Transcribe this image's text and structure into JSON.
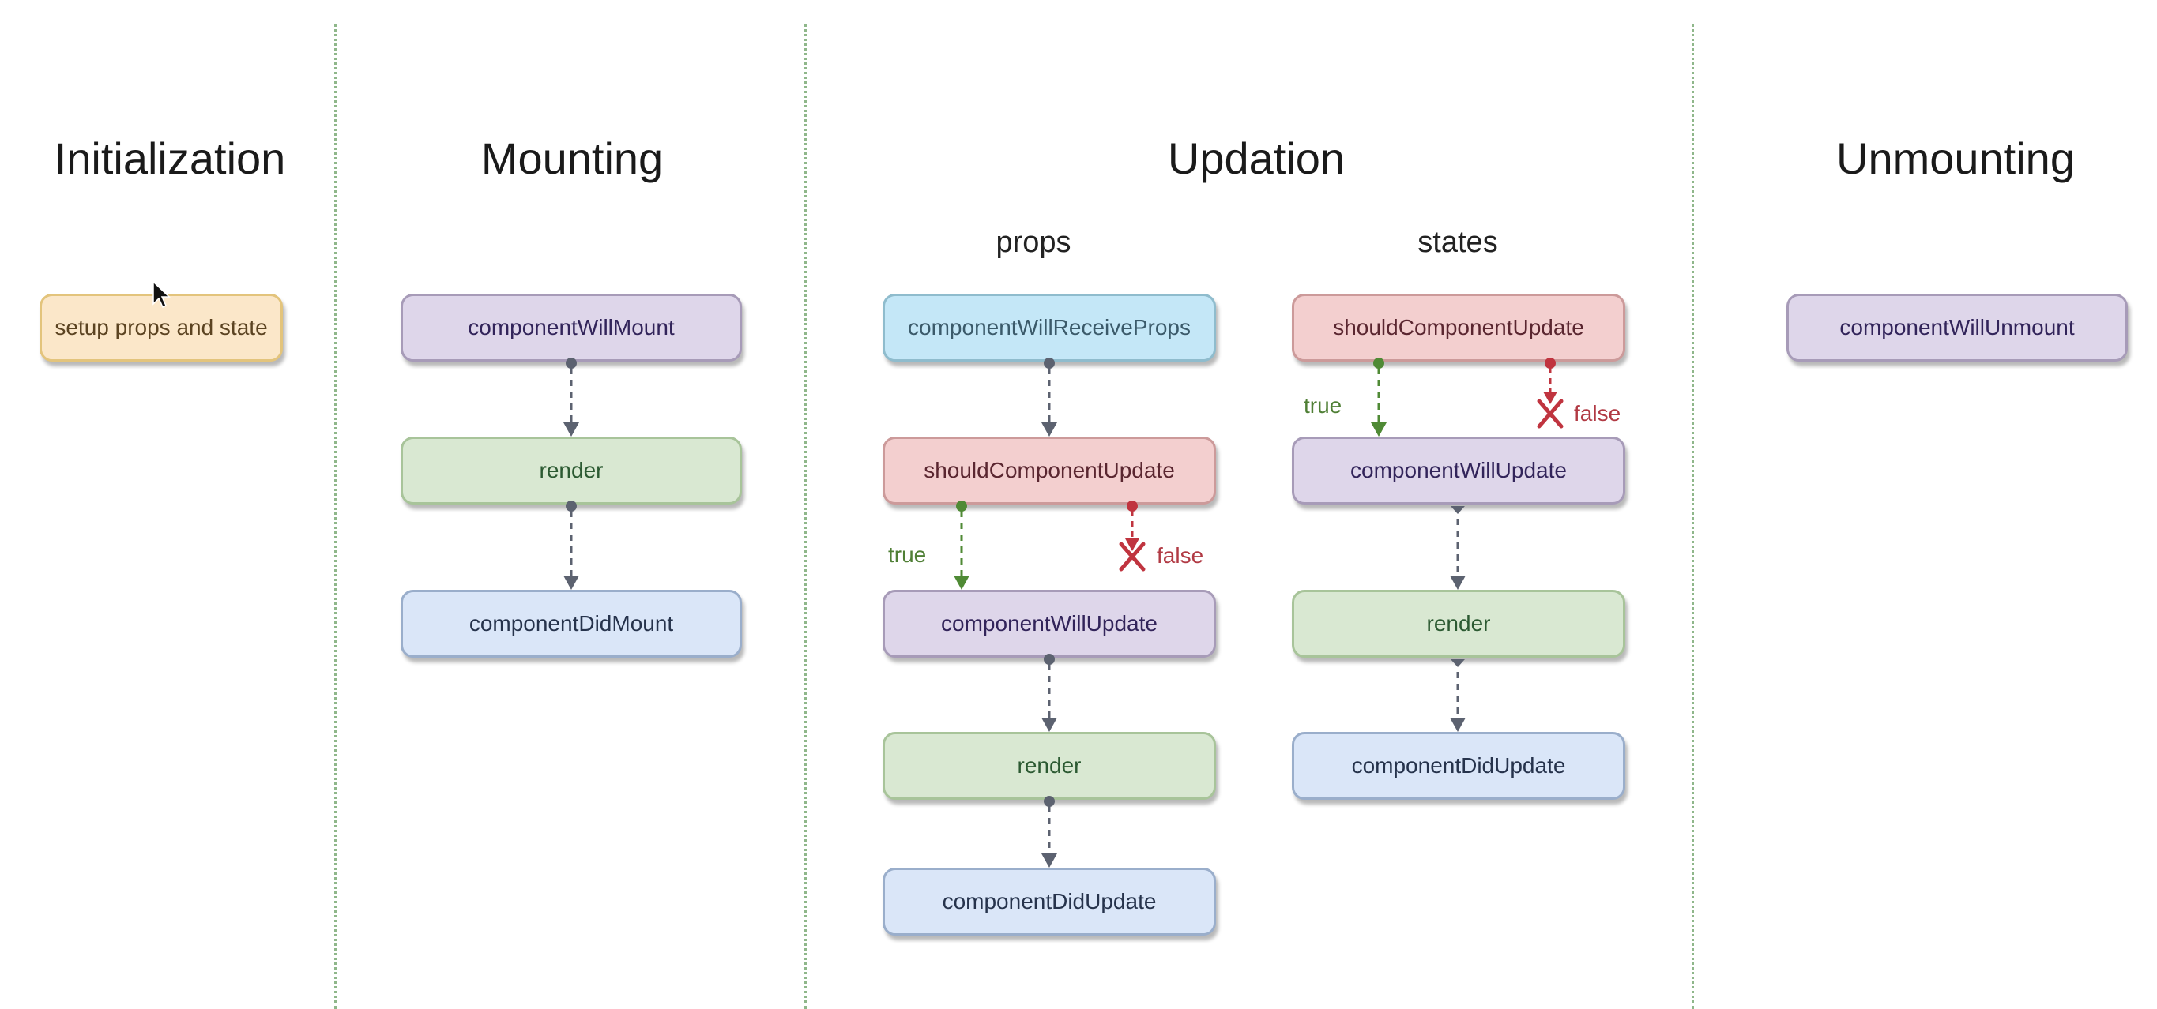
{
  "phases": {
    "initialization": {
      "title": "Initialization",
      "steps": [
        "setup props and state"
      ]
    },
    "mounting": {
      "title": "Mounting",
      "steps": [
        "componentWillMount",
        "render",
        "componentDidMount"
      ]
    },
    "updation": {
      "title": "Updation",
      "props": {
        "title": "props",
        "steps": [
          "componentWillReceiveProps",
          "shouldComponentUpdate",
          "componentWillUpdate",
          "render",
          "componentDidUpdate"
        ],
        "true_label": "true",
        "false_label": "false"
      },
      "states": {
        "title": "states",
        "steps": [
          "shouldComponentUpdate",
          "componentWillUpdate",
          "render",
          "componentDidUpdate"
        ],
        "true_label": "true",
        "false_label": "false"
      }
    },
    "unmounting": {
      "title": "Unmounting",
      "steps": [
        "componentWillUnmount"
      ]
    }
  },
  "colors": {
    "arrow": "#5c6270",
    "true_branch": "#4f8a35",
    "false_branch": "#c0343f",
    "divider": "#8fb78a"
  }
}
